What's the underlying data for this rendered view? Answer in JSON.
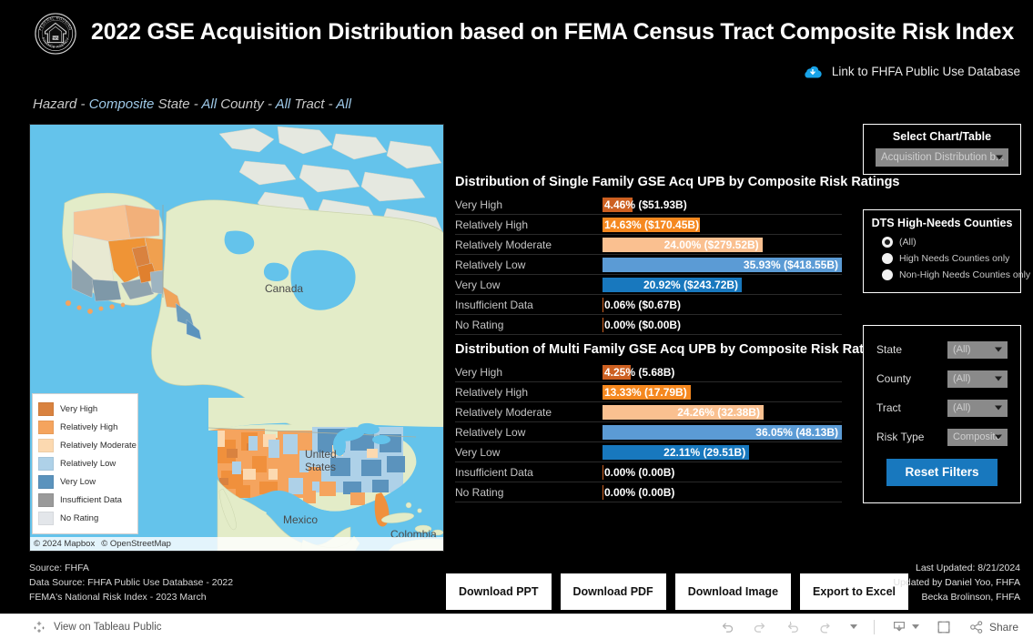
{
  "header": {
    "title": "2022 GSE Acquisition Distribution based on FEMA Census Tract Composite Risk Index",
    "logo_alt": "fhfa-seal",
    "link_label": "Link to FHFA Public Use Database",
    "link_icon": "cloud-download-icon"
  },
  "subtitle": {
    "hazard_label": "Hazard",
    "hazard_value": "Composite",
    "state_label": "State",
    "state_value": "All",
    "county_label": "County",
    "county_value": "All",
    "tract_label": "Tract",
    "tract_value": "All",
    "dash": "-"
  },
  "map": {
    "legend_title": "",
    "legend": [
      {
        "label": "Very High",
        "color": "#d9823f"
      },
      {
        "label": "Relatively High",
        "color": "#f5a45e"
      },
      {
        "label": "Relatively Moderate",
        "color": "#fcd9b0"
      },
      {
        "label": "Relatively Low",
        "color": "#aed1e8"
      },
      {
        "label": "Very Low",
        "color": "#5b93bd"
      },
      {
        "label": "Insufficient Data",
        "color": "#9a9a9a"
      },
      {
        "label": "No Rating",
        "color": "#e3e6ea"
      }
    ],
    "country_labels": [
      "Canada",
      "United",
      "States",
      "Mexico",
      "Colombia"
    ],
    "attribution": [
      "© 2024 Mapbox",
      "© OpenStreetMap"
    ],
    "ocean_color": "#64c3eb",
    "land_color": "#e3ecc8"
  },
  "chart_data": [
    {
      "type": "bar",
      "title": "Distribution of Single Family GSE Acq UPB by Composite Risk Ratings",
      "xlabel": "",
      "ylabel": "",
      "categories": [
        "Very High",
        "Relatively High",
        "Relatively Moderate",
        "Relatively Low",
        "Very Low",
        "Insufficient Data",
        "No Rating"
      ],
      "values": [
        4.46,
        14.63,
        24.0,
        35.93,
        20.92,
        0.06,
        0.0
      ],
      "value_labels": [
        "4.46% ($51.93B)",
        "14.63% ($170.45B)",
        "24.00% ($279.52B)",
        "35.93% ($418.55B)",
        "20.92% ($243.72B)",
        "0.06% ($0.67B)",
        "0.00% ($0.00B)"
      ],
      "amounts_usd_billions": [
        51.93,
        170.45,
        279.52,
        418.55,
        243.72,
        0.67,
        0.0
      ],
      "colors": [
        "#cd6021",
        "#f5881f",
        "#fac090",
        "#5b9bd5",
        "#1878be",
        "#cd6021",
        "#cd6021"
      ],
      "xlim": [
        0,
        35.93
      ],
      "grid": false,
      "legend": "none"
    },
    {
      "type": "bar",
      "title": "Distribution of Multi Family GSE Acq UPB by Composite Risk Ratings",
      "xlabel": "",
      "ylabel": "",
      "categories": [
        "Very High",
        "Relatively High",
        "Relatively Moderate",
        "Relatively Low",
        "Very Low",
        "Insufficient Data",
        "No Rating"
      ],
      "values": [
        4.25,
        13.33,
        24.26,
        36.05,
        22.11,
        0.0,
        0.0
      ],
      "value_labels": [
        "4.25% (5.68B)",
        "13.33% (17.79B)",
        "24.26% (32.38B)",
        "36.05% (48.13B)",
        "22.11% (29.51B)",
        "0.00% (0.00B)",
        "0.00% (0.00B)"
      ],
      "amounts_usd_billions": [
        5.68,
        17.79,
        32.38,
        48.13,
        29.51,
        0.0,
        0.0
      ],
      "colors": [
        "#cd6021",
        "#f5881f",
        "#fac090",
        "#5b9bd5",
        "#1878be",
        "#cd6021",
        "#cd6021"
      ],
      "xlim": [
        0,
        36.05
      ],
      "grid": false,
      "legend": "none"
    }
  ],
  "select_chart_panel": {
    "title": "Select Chart/Table",
    "selected": "Acquisition Distribution b...",
    "caret_icon": "chevron-down-icon"
  },
  "dts_panel": {
    "title": "DTS High-Needs Counties",
    "options": [
      {
        "label": "(All)",
        "selected": true
      },
      {
        "label": "High Needs Counties only",
        "selected": false
      },
      {
        "label": "Non-High Needs Counties only",
        "selected": false
      }
    ]
  },
  "filters_panel": {
    "rows": [
      {
        "label": "State",
        "value": "(All)"
      },
      {
        "label": "County",
        "value": "(All)"
      },
      {
        "label": "Tract",
        "value": "(All)"
      },
      {
        "label": "Risk Type",
        "value": "Composite"
      }
    ],
    "reset_label": "Reset Filters",
    "reset_color": "#1878be"
  },
  "source": {
    "lines": [
      "Source:  FHFA",
      "Data Source: FHFA Public Use Database -  2022",
      "FEMA's National Risk Index - 2023 March"
    ]
  },
  "download_buttons": [
    {
      "label": "Download PPT"
    },
    {
      "label": "Download PDF"
    },
    {
      "label": "Download Image"
    },
    {
      "label": "Export to Excel"
    }
  ],
  "updated": {
    "lines": [
      "Last Updated: 8/21/2024",
      "Updated by Daniel Yoo, FHFA",
      "Becka Brolinson, FHFA"
    ]
  },
  "tableau_bar": {
    "view_label": "View on Tableau Public",
    "tableau_icon": "tableau-logo-icon",
    "share_label": "Share",
    "icons": [
      "undo-icon",
      "redo-icon",
      "revert-icon",
      "refresh-icon",
      "chevron-down-icon",
      "download-icon",
      "fullscreen-icon",
      "share-icon"
    ]
  }
}
